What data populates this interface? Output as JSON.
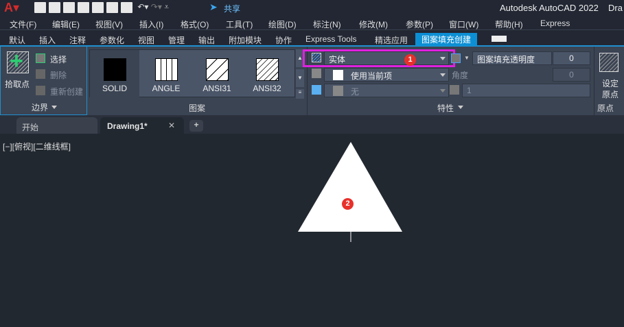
{
  "title": {
    "app": "Autodesk AutoCAD 2022",
    "doc": "Dra",
    "share": "共享"
  },
  "menu": [
    "文件(F)",
    "编辑(E)",
    "视图(V)",
    "插入(I)",
    "格式(O)",
    "工具(T)",
    "绘图(D)",
    "标注(N)",
    "修改(M)",
    "参数(P)",
    "窗口(W)",
    "帮助(H)",
    "Express"
  ],
  "ribbon_tabs": [
    "默认",
    "插入",
    "注释",
    "参数化",
    "视图",
    "管理",
    "输出",
    "附加模块",
    "协作",
    "Express Tools",
    "精选应用",
    "图案填充创建"
  ],
  "boundary": {
    "pick": "拾取点",
    "select": "选择",
    "remove": "删除",
    "recreate": "重新创建",
    "title": "边界"
  },
  "pattern": {
    "items": [
      "SOLID",
      "ANGLE",
      "ANSI31",
      "ANSI32"
    ],
    "title": "图案"
  },
  "properties": {
    "type": "实体",
    "color": "使用当前项",
    "bg": "无",
    "transparency_label": "图案填充透明度",
    "transparency": "0",
    "angle_label": "角度",
    "angle": "0",
    "scale": "1",
    "title": "特性"
  },
  "origin": {
    "set": "设定",
    "set2": "原点",
    "title": "原点"
  },
  "doc_tabs": {
    "start": "开始",
    "drawing": "Drawing1*",
    "add": "+",
    "close": "✕"
  },
  "viewport_label": "[−][俯视][二维线框]",
  "badges": [
    "1",
    "2"
  ],
  "colors": {
    "accent": "#0d8fd4",
    "highlight": "#e020e0",
    "badge": "#e8302a"
  }
}
